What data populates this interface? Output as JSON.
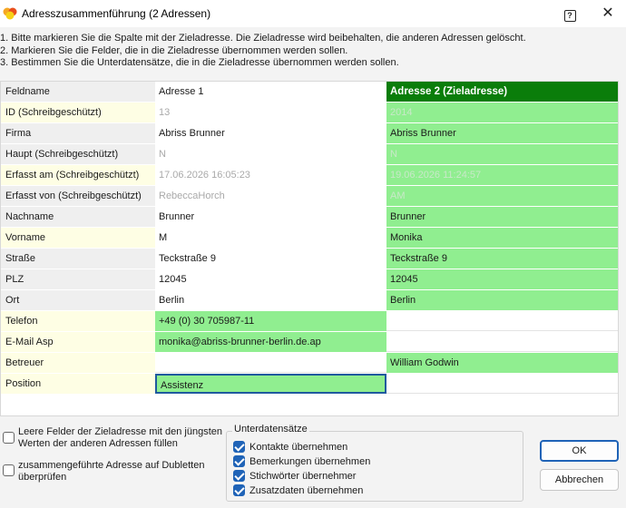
{
  "window": {
    "title": "Adresszusammenführung (2 Adressen)",
    "help_glyph": "?",
    "close_glyph": "✕"
  },
  "instructions": [
    "1. Bitte markieren Sie die Spalte mit der Zieladresse. Die Zieladresse wird beibehalten, die anderen Adressen gelöscht.",
    "2. Markieren Sie die Felder, die in die Zieladresse übernommen werden sollen.",
    "3. Bestimmen Sie die Unterdatensätze, die in die Zieladresse übernommen werden sollen."
  ],
  "grid": {
    "headers": [
      "Feldname",
      "Adresse 1",
      "Adresse 2 (Zieladresse)"
    ],
    "rows": [
      {
        "field": "ID (Schreibgeschützt)",
        "a1": "13",
        "a2": "2014"
      },
      {
        "field": "Firma",
        "a1": "Abriss Brunner",
        "a2": "Abriss Brunner"
      },
      {
        "field": "Haupt (Schreibgeschützt)",
        "a1": "N",
        "a2": "N"
      },
      {
        "field": "Erfasst am (Schreibgeschützt)",
        "a1": "17.06.2026 16:05:23",
        "a2": "19.06.2026 11:24:57"
      },
      {
        "field": "Erfasst von (Schreibgeschützt)",
        "a1": "RebeccaHorch",
        "a2": "AM"
      },
      {
        "field": "Nachname",
        "a1": "Brunner",
        "a2": "Brunner"
      },
      {
        "field": "Vorname",
        "a1": "M",
        "a2": "Monika"
      },
      {
        "field": "Straße",
        "a1": "Teckstraße 9",
        "a2": "Teckstraße 9"
      },
      {
        "field": "PLZ",
        "a1": "12045",
        "a2": "12045"
      },
      {
        "field": "Ort",
        "a1": "Berlin",
        "a2": "Berlin"
      },
      {
        "field": "Telefon",
        "a1": "+49 (0) 30 705987-11",
        "a2": ""
      },
      {
        "field": "E-Mail Asp",
        "a1": "monika@abriss-brunner-berlin.de.ap",
        "a2": ""
      },
      {
        "field": "Betreuer",
        "a1": "",
        "a2": "William Godwin"
      },
      {
        "field": "Position",
        "a1": "Assistenz",
        "a2": ""
      }
    ]
  },
  "options": {
    "fill_empty": "Leere Felder der Zieladresse mit den jüngsten Werten der anderen Adressen füllen",
    "check_duplicates": "zusammengeführte Adresse auf Dubletten überprüfen"
  },
  "subrecords": {
    "title": "Unterdatensätze",
    "items": [
      {
        "label": "Kontakte übernehmen",
        "checked": true
      },
      {
        "label": "Bemerkungen übernehmen",
        "checked": true
      },
      {
        "label": "Stichwörter übernehmer",
        "checked": true
      },
      {
        "label": "Zusatzdaten übernehmen",
        "checked": true
      }
    ]
  },
  "buttons": {
    "ok": "OK",
    "cancel": "Abbrechen"
  },
  "colors": {
    "target_header": "#0a7d0a",
    "selected_field": "#90ee90",
    "readonly_field": "#fefee4"
  }
}
